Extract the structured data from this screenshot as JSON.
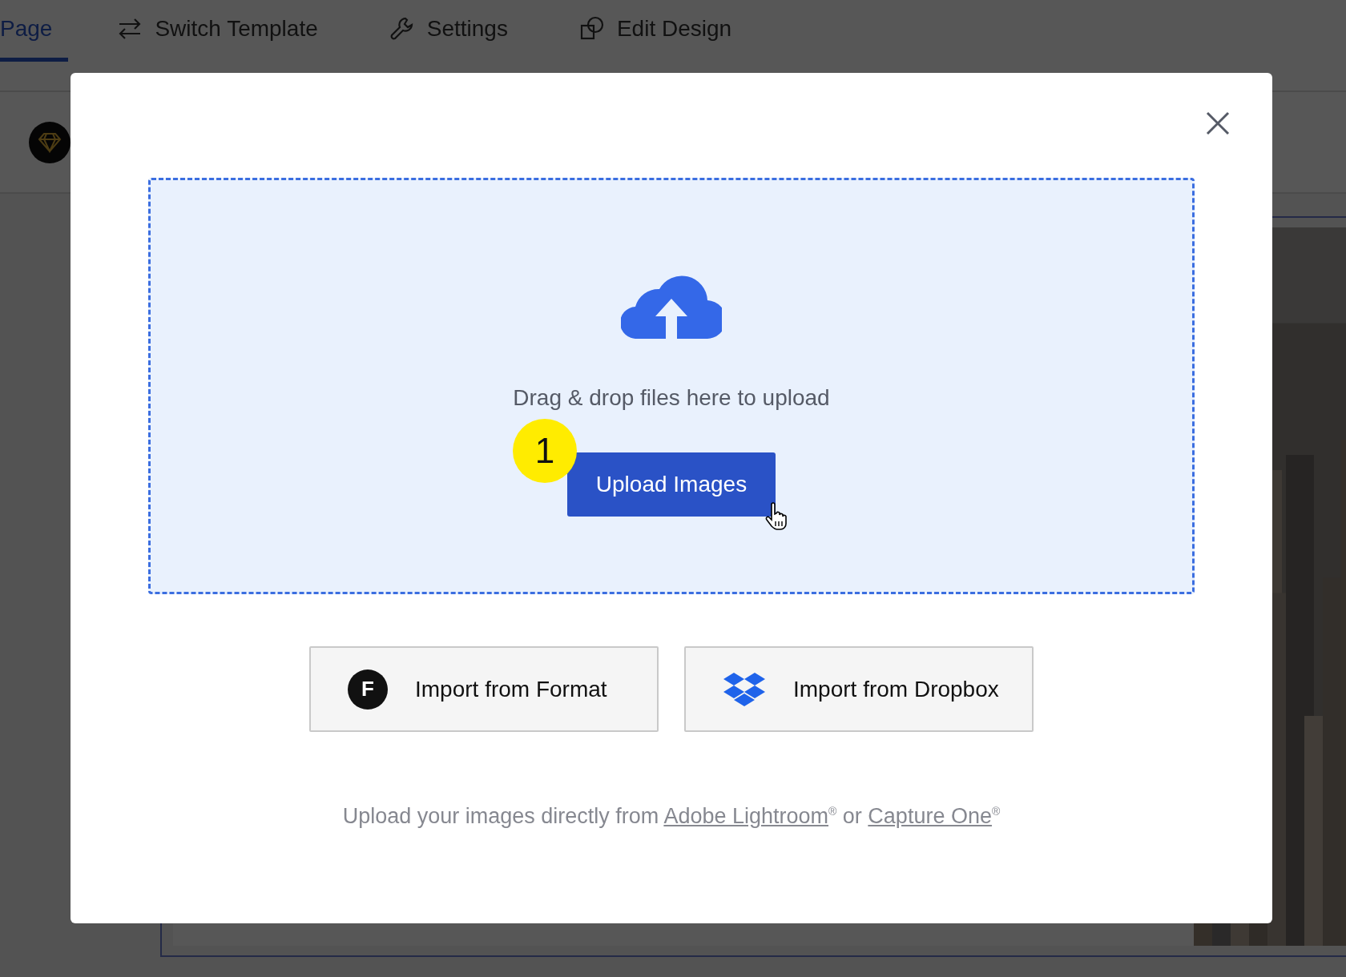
{
  "tabs": [
    {
      "kind": "plain",
      "label": "Page",
      "selected": true
    },
    {
      "kind": "swap",
      "label": "Switch Template",
      "selected": false
    },
    {
      "kind": "wrench",
      "label": "Settings",
      "selected": false
    },
    {
      "kind": "shapes",
      "label": "Edit Design",
      "selected": false
    }
  ],
  "modal": {
    "dropzone": {
      "text": "Drag & drop files here to upload",
      "button": "Upload Images",
      "step_badge": "1"
    },
    "import_buttons": [
      {
        "kind": "format",
        "label": "Import from Format",
        "logo_letter": "F"
      },
      {
        "kind": "dropbox",
        "label": "Import from Dropbox"
      }
    ],
    "footer": [
      {
        "kind": "text",
        "text": "Upload your images directly from "
      },
      {
        "kind": "link",
        "text": "Adobe Lightroom"
      },
      {
        "kind": "sup",
        "text": "®"
      },
      {
        "kind": "text",
        "text": " or "
      },
      {
        "kind": "link",
        "text": "Capture One"
      },
      {
        "kind": "sup",
        "text": "®"
      }
    ]
  }
}
